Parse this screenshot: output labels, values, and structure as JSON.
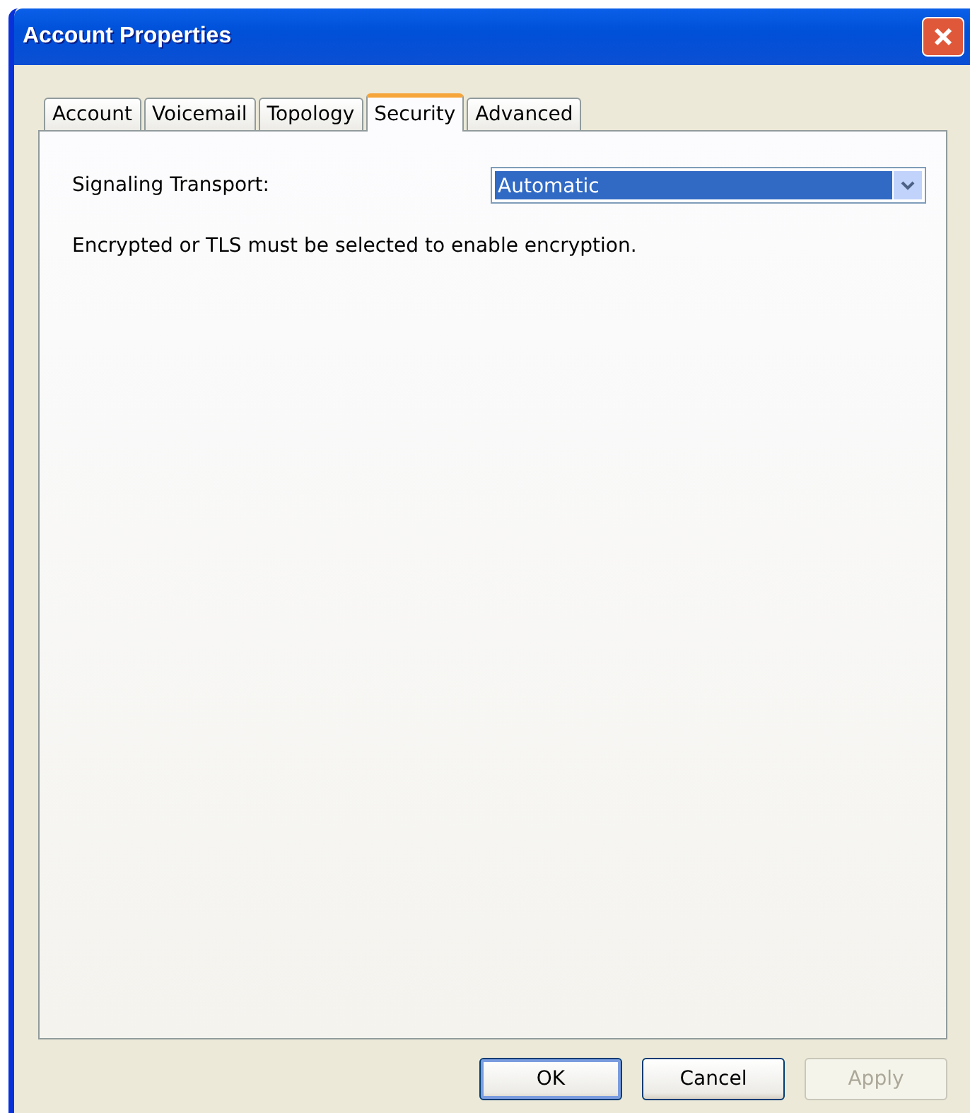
{
  "window": {
    "title": "Account Properties"
  },
  "tabs": [
    {
      "label": "Account",
      "selected": false
    },
    {
      "label": "Voicemail",
      "selected": false
    },
    {
      "label": "Topology",
      "selected": false
    },
    {
      "label": "Security",
      "selected": true
    },
    {
      "label": "Advanced",
      "selected": false
    }
  ],
  "transport": {
    "label": "Signaling Transport:",
    "value": "Automatic"
  },
  "note": "Encrypted or TLS must be selected to enable encryption.",
  "buttons": [
    {
      "label": "OK",
      "default": true,
      "disabled": false
    },
    {
      "label": "Cancel",
      "default": false,
      "disabled": false
    },
    {
      "label": "Apply",
      "default": false,
      "disabled": true
    }
  ]
}
